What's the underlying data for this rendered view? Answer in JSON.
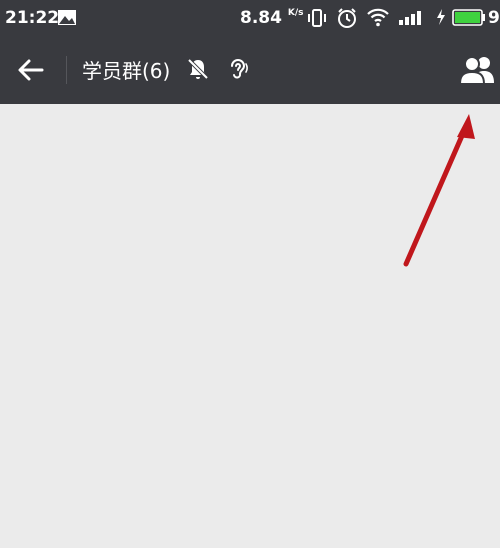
{
  "status_bar": {
    "time": "21:22",
    "net_speed": "8.84",
    "net_speed_unit": "K/s",
    "battery_percent": "9",
    "icons": [
      "image-notification-icon",
      "vibrate-icon",
      "alarm-icon",
      "wifi-icon",
      "signal-icon",
      "charging-icon",
      "battery-icon"
    ],
    "battery_color": "#3fd13f"
  },
  "header": {
    "title": "学员群(6)",
    "back_icon": "arrow-left-icon",
    "mute_icon": "mute-bell-icon",
    "earpiece_icon": "ear-icon",
    "members_icon": "group-members-icon",
    "background": "#393a3f"
  },
  "annotation": {
    "arrow_color": "#c0171c",
    "points_to": "group-members-button"
  }
}
